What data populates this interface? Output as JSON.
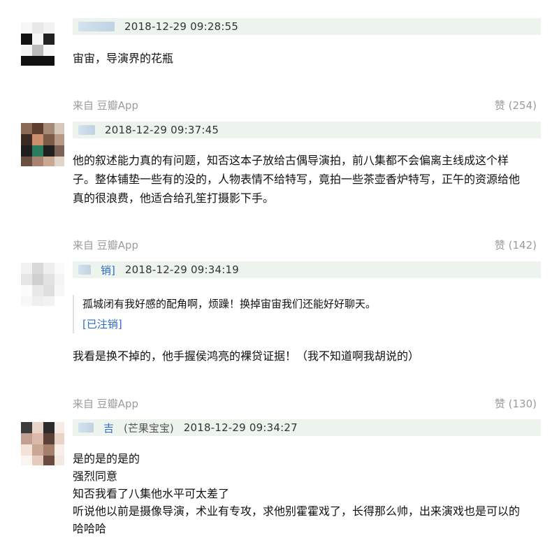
{
  "comments": [
    {
      "username": "",
      "user_tag": "",
      "timestamp": "2018-12-29 09:28:55",
      "body": [
        "宙宙，导演界的花瓶"
      ],
      "source": "来自 豆瓣App",
      "likes": "赞 (254)"
    },
    {
      "username": "",
      "user_tag": "",
      "timestamp": "2018-12-29 09:37:45",
      "body": [
        "他的叙述能力真的有问题，知否这本子放给古偶导演拍，前八集都不会偏离主线成这个样",
        "子。整体铺垫一些有的没的，人物表情不给特写，竟拍一些茶壶香炉特写，正午的资源给他",
        "真的很浪费，他适合给孔笙打摄影下手。"
      ],
      "source": "来自 豆瓣App",
      "likes": "赞 (142)"
    },
    {
      "username": "销]",
      "user_tag": "",
      "timestamp": "2018-12-29 09:34:19",
      "quote": {
        "text": "孤城闭有我好感的配角啊，烦躁！换掉宙宙我们还能好好聊天。",
        "cancel_label": "[已注销]"
      },
      "body": [
        "我看是换不掉的，他手握侯鸿亮的裸贷证据！（我不知道啊我胡说的）"
      ],
      "source": "来自 豆瓣App",
      "likes": "赞 (130)"
    },
    {
      "username": "吉",
      "user_tag": "(芒果宝宝)",
      "timestamp": "2018-12-29 09:34:27",
      "body": [
        "是的是的是的",
        "强烈同意",
        "知否我看了八集他水平可太差了",
        "听说他以前是摄像导演，术业有专攻，求他别霍霍戏了，长得那么帅，出来演戏也是可以的",
        "哈哈哈"
      ]
    }
  ],
  "colors": {
    "meta_bar_bg": "#edf4ed",
    "link_blue": "#2d6ac6",
    "muted_gray": "#9b9b9b"
  },
  "icons": {
    "avatar": "pixelated-avatar-icon"
  }
}
